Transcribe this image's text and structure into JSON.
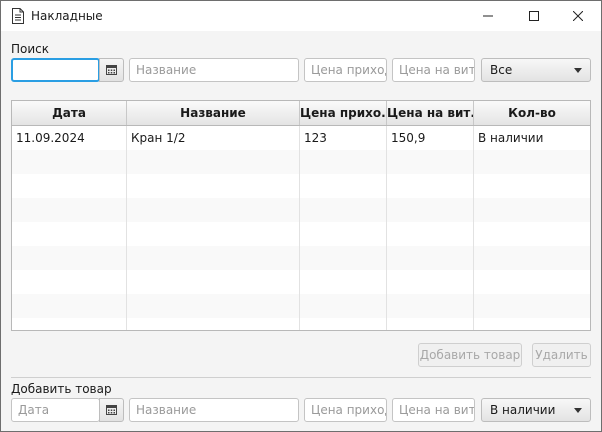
{
  "window": {
    "title": "Накладные",
    "icon": "document-icon"
  },
  "search": {
    "label": "Поиск",
    "date_value": "",
    "name_placeholder": "Название",
    "price_in_placeholder": "Цена прихода",
    "price_shelf_placeholder": "Цена на витрине",
    "filter_selected": "Все"
  },
  "table": {
    "columns": [
      "Дата",
      "Название",
      "Цена прихо...",
      "Цена на вит...",
      "Кол-во"
    ],
    "rows": [
      {
        "date": "11.09.2024",
        "name": "Кран 1/2",
        "price_in": "123",
        "price_shelf": "150,9",
        "qty": "В наличии"
      }
    ]
  },
  "actions": {
    "add_label": "Добавить товар",
    "delete_label": "Удалить"
  },
  "add_form": {
    "label": "Добавить товар",
    "date_placeholder": "Дата",
    "name_placeholder": "Название",
    "price_in_placeholder": "Цена прихода",
    "price_shelf_placeholder": "Цена на витрине",
    "status_selected": "В наличии"
  },
  "colors": {
    "focus_border": "#2a9ee3"
  }
}
